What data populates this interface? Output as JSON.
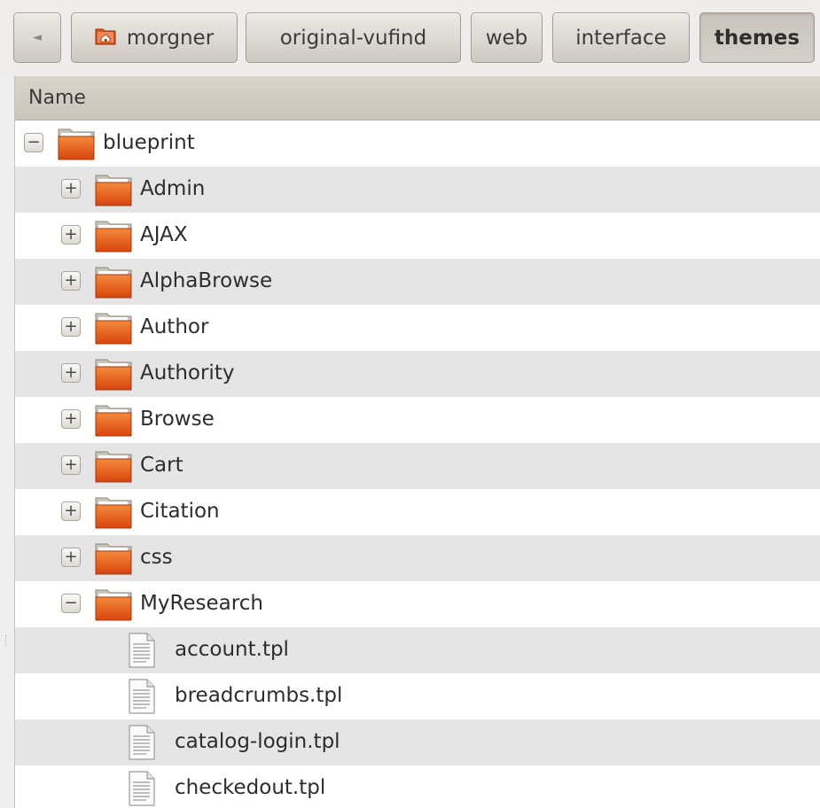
{
  "breadcrumbs": [
    {
      "label": "◄",
      "kind": "back"
    },
    {
      "label": "morgner",
      "kind": "home"
    },
    {
      "label": "original-vufind",
      "kind": "dir"
    },
    {
      "label": "web",
      "kind": "dir"
    },
    {
      "label": "interface",
      "kind": "dir"
    },
    {
      "label": "themes",
      "kind": "dir",
      "active": true
    }
  ],
  "list": {
    "column_header": "Name",
    "rows": [
      {
        "name": "blueprint",
        "type": "folder",
        "level": 0,
        "expander": "−"
      },
      {
        "name": "Admin",
        "type": "folder",
        "level": 1,
        "expander": "+"
      },
      {
        "name": "AJAX",
        "type": "folder",
        "level": 1,
        "expander": "+"
      },
      {
        "name": "AlphaBrowse",
        "type": "folder",
        "level": 1,
        "expander": "+"
      },
      {
        "name": "Author",
        "type": "folder",
        "level": 1,
        "expander": "+"
      },
      {
        "name": "Authority",
        "type": "folder",
        "level": 1,
        "expander": "+"
      },
      {
        "name": "Browse",
        "type": "folder",
        "level": 1,
        "expander": "+"
      },
      {
        "name": "Cart",
        "type": "folder",
        "level": 1,
        "expander": "+"
      },
      {
        "name": "Citation",
        "type": "folder",
        "level": 1,
        "expander": "+"
      },
      {
        "name": "css",
        "type": "folder",
        "level": 1,
        "expander": "+"
      },
      {
        "name": "MyResearch",
        "type": "folder",
        "level": 1,
        "expander": "−"
      },
      {
        "name": "account.tpl",
        "type": "file",
        "level": 2
      },
      {
        "name": "breadcrumbs.tpl",
        "type": "file",
        "level": 2
      },
      {
        "name": "catalog-login.tpl",
        "type": "file",
        "level": 2
      },
      {
        "name": "checkedout.tpl",
        "type": "file",
        "level": 2
      }
    ]
  },
  "colors": {
    "folder": "#e25a12",
    "row_alt": "#e5e5e5",
    "header": "#d2ccc3"
  },
  "icons": {
    "folder": "folder-icon",
    "file": "text-file-icon",
    "home": "home-folder-icon"
  }
}
